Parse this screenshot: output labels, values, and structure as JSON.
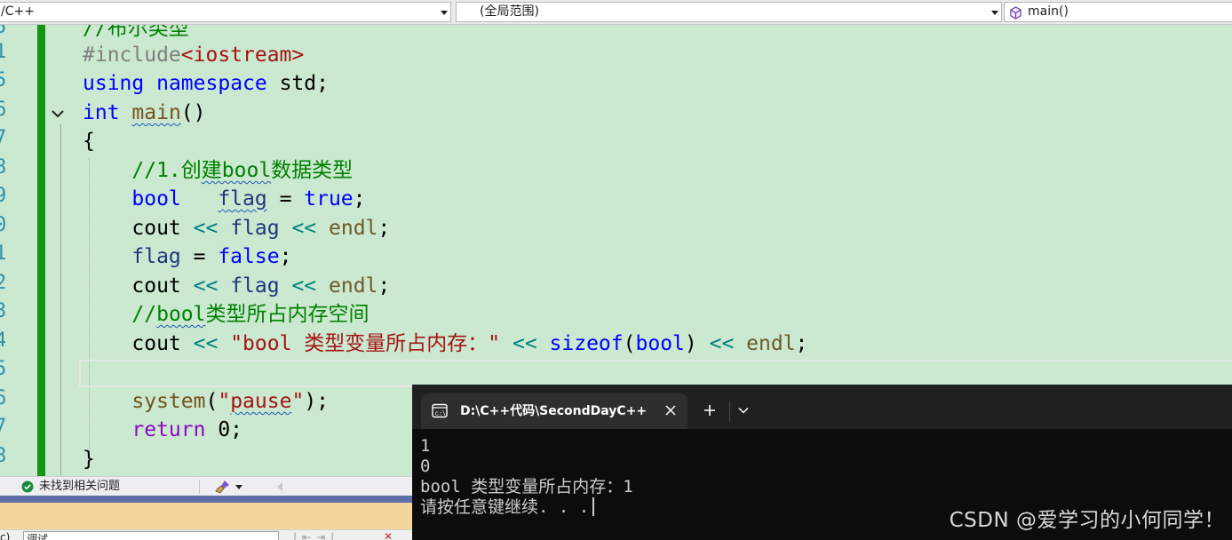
{
  "navbar": {
    "project": "/C++",
    "scope": "(全局范围)",
    "member": "main()"
  },
  "gutter": {
    "line_numbers": [
      "5",
      "1",
      "5",
      "6",
      "7",
      "8",
      "9",
      "0",
      "1",
      "2",
      "3",
      "4",
      "5",
      "6",
      "7",
      "8"
    ]
  },
  "status": {
    "issues_text": "未找到相关问题"
  },
  "bottom_panel": {
    "prefix": "c)",
    "field_value": "调试"
  },
  "terminal": {
    "tab_title": "D:\\C++代码\\SecondDayC++\\x",
    "output_lines": [
      "1",
      "0",
      "bool 类型变量所占内存：1",
      "请按任意键继续. . ."
    ]
  },
  "watermark": "CSDN @爱学习的小何同学！",
  "colors": {
    "editor_background": "#cbe8d0",
    "change_bar": "#149414",
    "keyword": "#0000ff",
    "comment": "#008000",
    "string": "#a31515",
    "terminal_background": "#0c0c0c"
  }
}
